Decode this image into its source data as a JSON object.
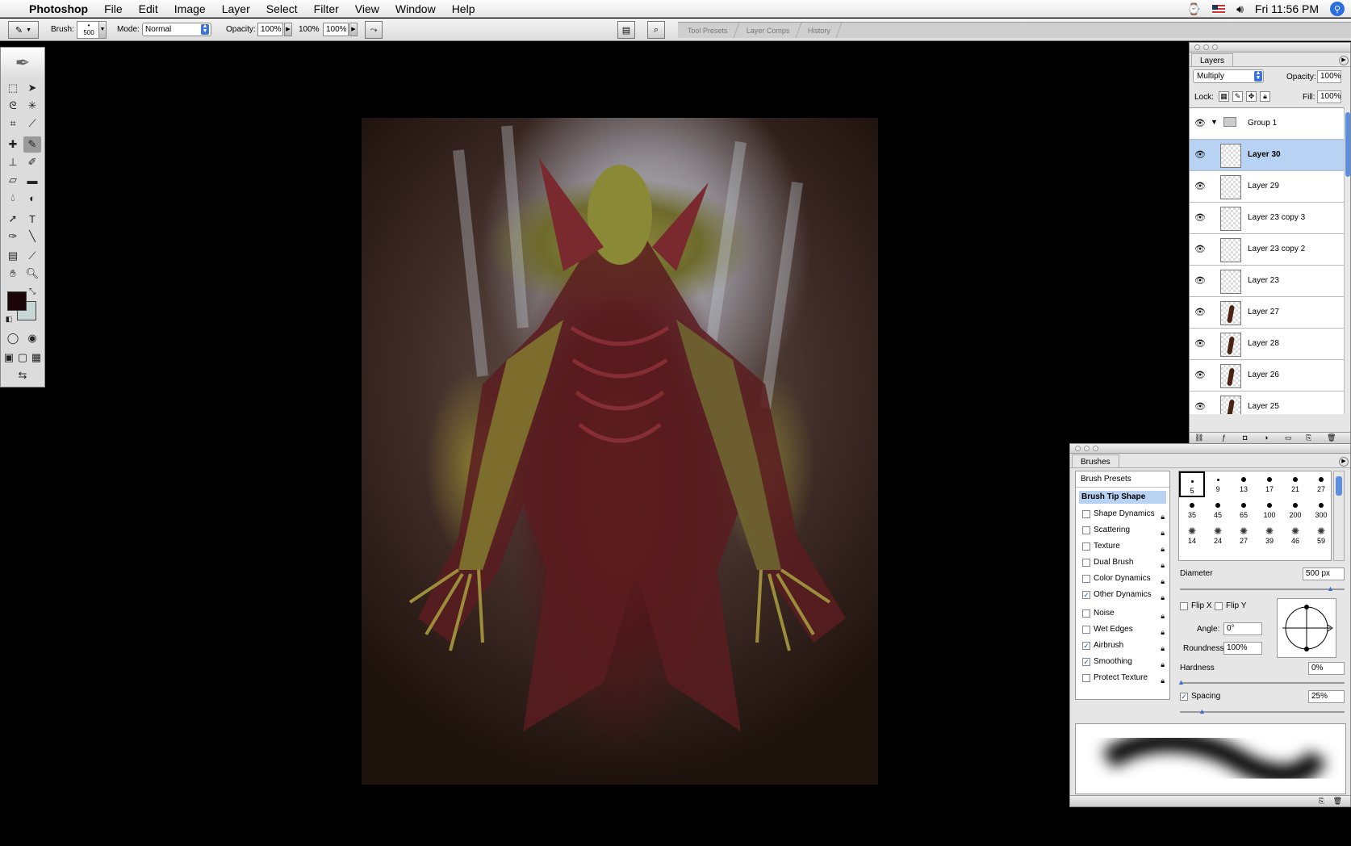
{
  "menubar": {
    "app_name": "Photoshop",
    "menus": [
      "File",
      "Edit",
      "Image",
      "Layer",
      "Select",
      "Filter",
      "View",
      "Window",
      "Help"
    ],
    "clock": "Fri 11:56 PM"
  },
  "options": {
    "brush_label": "Brush:",
    "brush_size": "500",
    "mode_label": "Mode:",
    "mode_value": "Normal",
    "opacity_label": "Opacity:",
    "opacity_value": "100%",
    "flow_label": "100%",
    "flow_value": "100%",
    "well_tabs": [
      "Tool Presets",
      "Layer Comps",
      "History"
    ]
  },
  "toolbox": {
    "colors": {
      "foreground": "#1c0508",
      "background": "#c8d6d5"
    }
  },
  "layers_panel": {
    "tab": "Layers",
    "blend_mode": "Multiply",
    "opacity_label": "Opacity:",
    "opacity_value": "100%",
    "lock_label": "Lock:",
    "fill_label": "Fill:",
    "fill_value": "100%",
    "group_name": "Group 1",
    "layers": [
      {
        "name": "Layer 30",
        "selected": true,
        "paint": false
      },
      {
        "name": "Layer 29",
        "selected": false,
        "paint": false
      },
      {
        "name": "Layer 23 copy 3",
        "selected": false,
        "paint": false
      },
      {
        "name": "Layer 23 copy 2",
        "selected": false,
        "paint": false
      },
      {
        "name": "Layer 23",
        "selected": false,
        "paint": false
      },
      {
        "name": "Layer 27",
        "selected": false,
        "paint": true
      },
      {
        "name": "Layer 28",
        "selected": false,
        "paint": true
      },
      {
        "name": "Layer 26",
        "selected": false,
        "paint": true
      },
      {
        "name": "Layer 25",
        "selected": false,
        "paint": true
      }
    ]
  },
  "brushes_panel": {
    "tab": "Brushes",
    "presets_label": "Brush Presets",
    "tip_shape_label": "Brush Tip Shape",
    "options": [
      {
        "label": "Shape Dynamics",
        "checked": false
      },
      {
        "label": "Scattering",
        "checked": false
      },
      {
        "label": "Texture",
        "checked": false
      },
      {
        "label": "Dual Brush",
        "checked": false
      },
      {
        "label": "Color Dynamics",
        "checked": false
      },
      {
        "label": "Other Dynamics",
        "checked": true
      },
      {
        "label": "Noise",
        "checked": false
      },
      {
        "label": "Wet Edges",
        "checked": false
      },
      {
        "label": "Airbrush",
        "checked": true
      },
      {
        "label": "Smoothing",
        "checked": true
      },
      {
        "label": "Protect Texture",
        "checked": false
      }
    ],
    "tip_sizes": [
      "5",
      "9",
      "13",
      "17",
      "21",
      "27",
      "35",
      "45",
      "65",
      "100",
      "200",
      "300",
      "14",
      "24",
      "27",
      "39",
      "46",
      "59"
    ],
    "diameter_label": "Diameter",
    "diameter_value": "500 px",
    "flip_x": "Flip X",
    "flip_y": "Flip Y",
    "angle_label": "Angle:",
    "angle_value": "0°",
    "roundness_label": "Roundness:",
    "roundness_value": "100%",
    "hardness_label": "Hardness",
    "hardness_value": "0%",
    "spacing_label": "Spacing",
    "spacing_value": "25%"
  }
}
